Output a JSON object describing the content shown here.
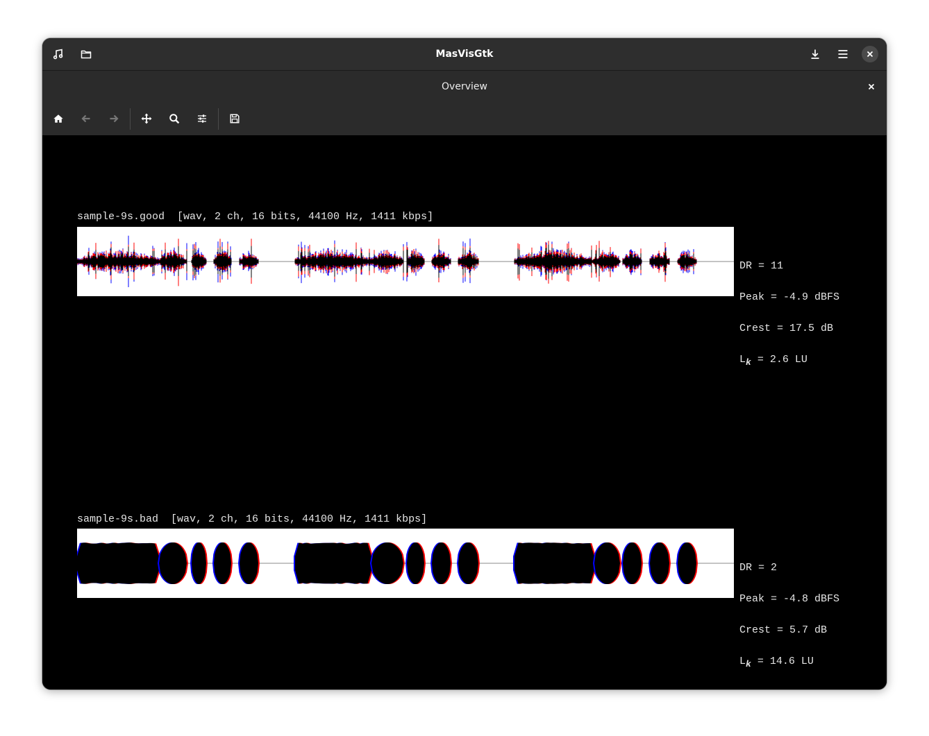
{
  "window": {
    "title": "MasVisGtk"
  },
  "header": {
    "left_icons": [
      "music-note-icon",
      "folder-icon"
    ],
    "right_icons": [
      "download-icon",
      "hamburger-menu-icon",
      "close-icon"
    ]
  },
  "tab": {
    "title": "Overview"
  },
  "toolbar": {
    "icons": [
      "home-icon",
      "back-arrow-icon",
      "forward-arrow-icon",
      "pan-icon",
      "zoom-icon",
      "configure-subplots-icon",
      "save-icon"
    ]
  },
  "colors": {
    "left_channel": "#0000ff",
    "right_channel": "#ff0000",
    "waveform": "#000000"
  },
  "tracks": [
    {
      "label": "sample-9s.good  [wav, 2 ch, 16 bits, 44100 Hz, 1411 kbps]",
      "dr": "DR = 11",
      "peak": "Peak = -4.9 dBFS",
      "crest": "Crest = 17.5 dB",
      "lk_prefix": "L",
      "lk_sub": "k",
      "lk_value": " = 2.6 LU",
      "lk_value_num": 2.6
    },
    {
      "label": "sample-9s.bad  [wav, 2 ch, 16 bits, 44100 Hz, 1411 kbps]",
      "dr": "DR = 2",
      "peak": "Peak = -4.8 dBFS",
      "crest": "Crest = 5.7 dB",
      "lk_prefix": "L",
      "lk_sub": "k",
      "lk_value": " = 14.6 LU",
      "lk_value_num": 14.6
    }
  ]
}
